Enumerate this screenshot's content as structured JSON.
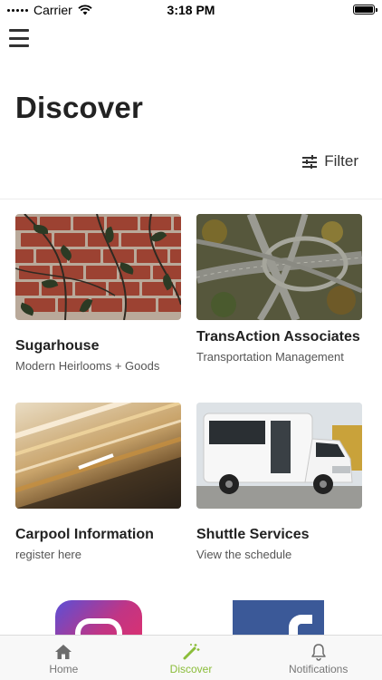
{
  "status": {
    "carrier": "Carrier",
    "time": "3:18 PM"
  },
  "header": {
    "title": "Discover",
    "filter_label": "Filter"
  },
  "cards": [
    {
      "title": "Sugarhouse",
      "subtitle": "Modern Heirlooms + Goods"
    },
    {
      "title": "TransAction Associates",
      "subtitle": "Transportation Management"
    },
    {
      "title": "Carpool Information",
      "subtitle": "register here"
    },
    {
      "title": "Shuttle Services",
      "subtitle": "View the schedule"
    }
  ],
  "tabs": [
    {
      "label": "Home",
      "icon": "home-icon"
    },
    {
      "label": "Discover",
      "icon": "magic-wand-icon"
    },
    {
      "label": "Notifications",
      "icon": "bell-icon"
    }
  ],
  "colors": {
    "accent": "#8bbd3a",
    "instagram": "#c13584",
    "facebook": "#3b5998"
  }
}
